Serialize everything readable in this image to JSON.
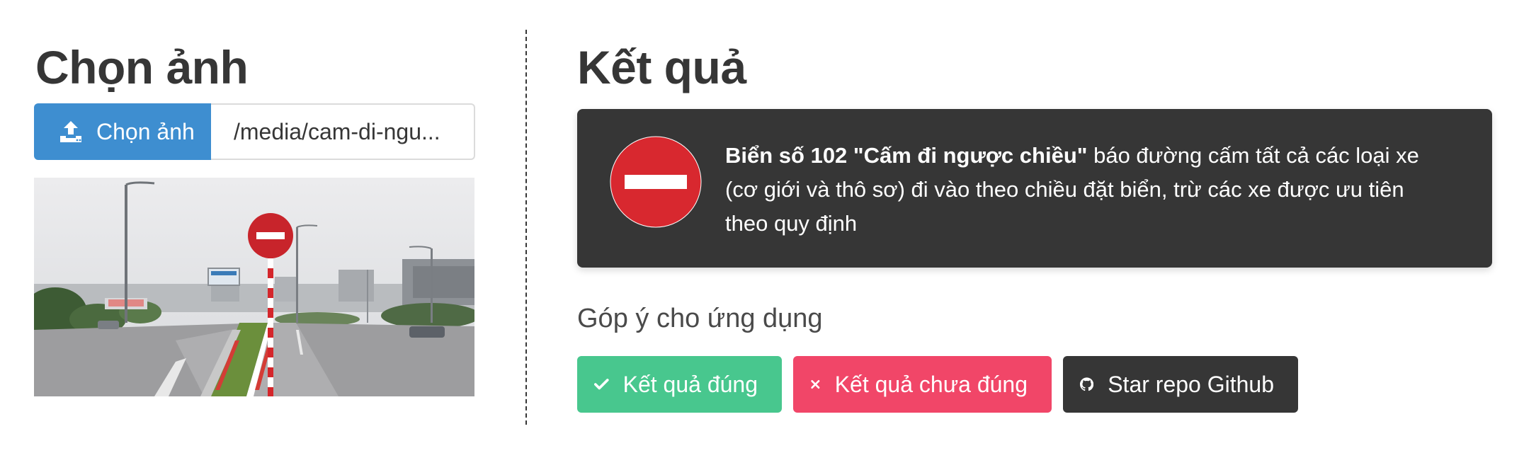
{
  "left": {
    "title": "Chọn ảnh",
    "upload": {
      "button_label": "Chọn ảnh",
      "file_name": "/media/cam-di-ngu..."
    }
  },
  "right": {
    "title": "Kết quả",
    "result": {
      "sign_name": "Biển số 102 \"Cấm đi ngược chiều\"",
      "description": " báo đường cấm tất cả các loại xe (cơ giới và thô sơ) đi vào theo chiều đặt biển, trừ các xe được ưu tiên theo quy định"
    },
    "feedback": {
      "title": "Góp ý cho ứng dụng",
      "correct_label": "Kết quả đúng",
      "incorrect_label": "Kết quả chưa đúng",
      "github_label": "Star repo Github"
    }
  },
  "colors": {
    "upload_button": "#3e8ed0",
    "result_bg": "#363636",
    "success": "#48c78e",
    "danger": "#f14668",
    "dark": "#363636",
    "sign_red": "#d8282f"
  },
  "icons": {
    "upload": "upload-icon",
    "sign": "no-entry-sign-icon",
    "check": "check-icon",
    "times": "close-icon",
    "github": "github-icon"
  }
}
